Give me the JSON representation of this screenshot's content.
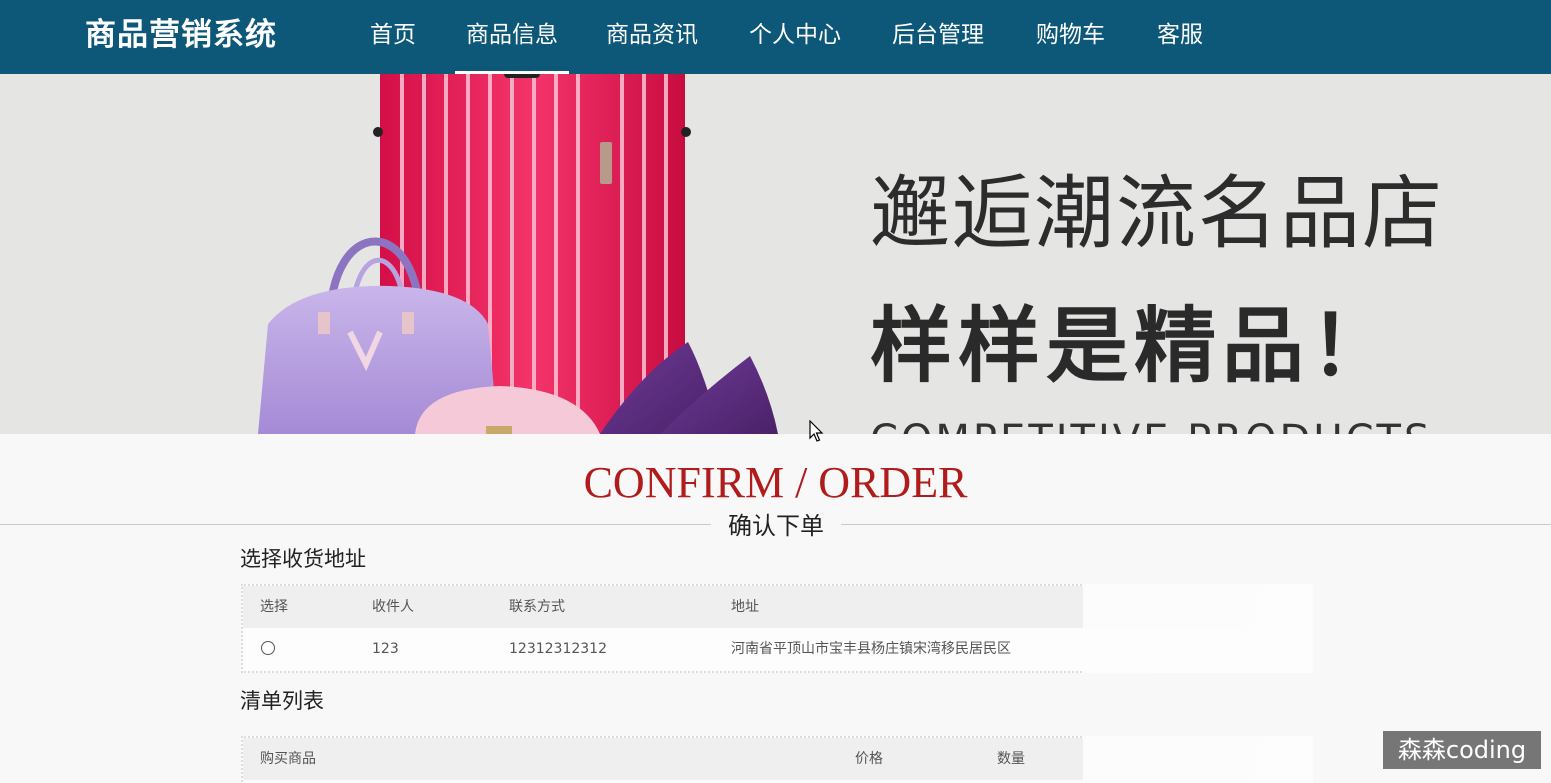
{
  "header": {
    "brand": "商品营销系统",
    "nav": [
      {
        "label": "首页"
      },
      {
        "label": "商品信息",
        "active": true
      },
      {
        "label": "商品资讯"
      },
      {
        "label": "个人中心"
      },
      {
        "label": "后台管理"
      },
      {
        "label": "购物车"
      },
      {
        "label": "客服"
      }
    ]
  },
  "banner": {
    "line1": "邂逅潮流名品店",
    "line2": "样样是精品！",
    "english": "COMPETITIVE PRODUCTS"
  },
  "heading": {
    "english": "CONFIRM / ORDER",
    "chinese": "确认下单"
  },
  "address_section": {
    "title": "选择收货地址",
    "columns": [
      "选择",
      "收件人",
      "联系方式",
      "地址"
    ],
    "rows": [
      {
        "selected": false,
        "recipient": "123",
        "phone": "12312312312",
        "address": "河南省平顶山市宝丰县杨庄镇宋湾移民居民区"
      }
    ]
  },
  "items_section": {
    "title": "清单列表",
    "columns": [
      "购买商品",
      "价格",
      "数量"
    ]
  },
  "watermark": "森森coding",
  "colors": {
    "nav_bg": "#0d5779",
    "heading_red": "#b01c1c",
    "page_bg": "#f7f8f7"
  }
}
